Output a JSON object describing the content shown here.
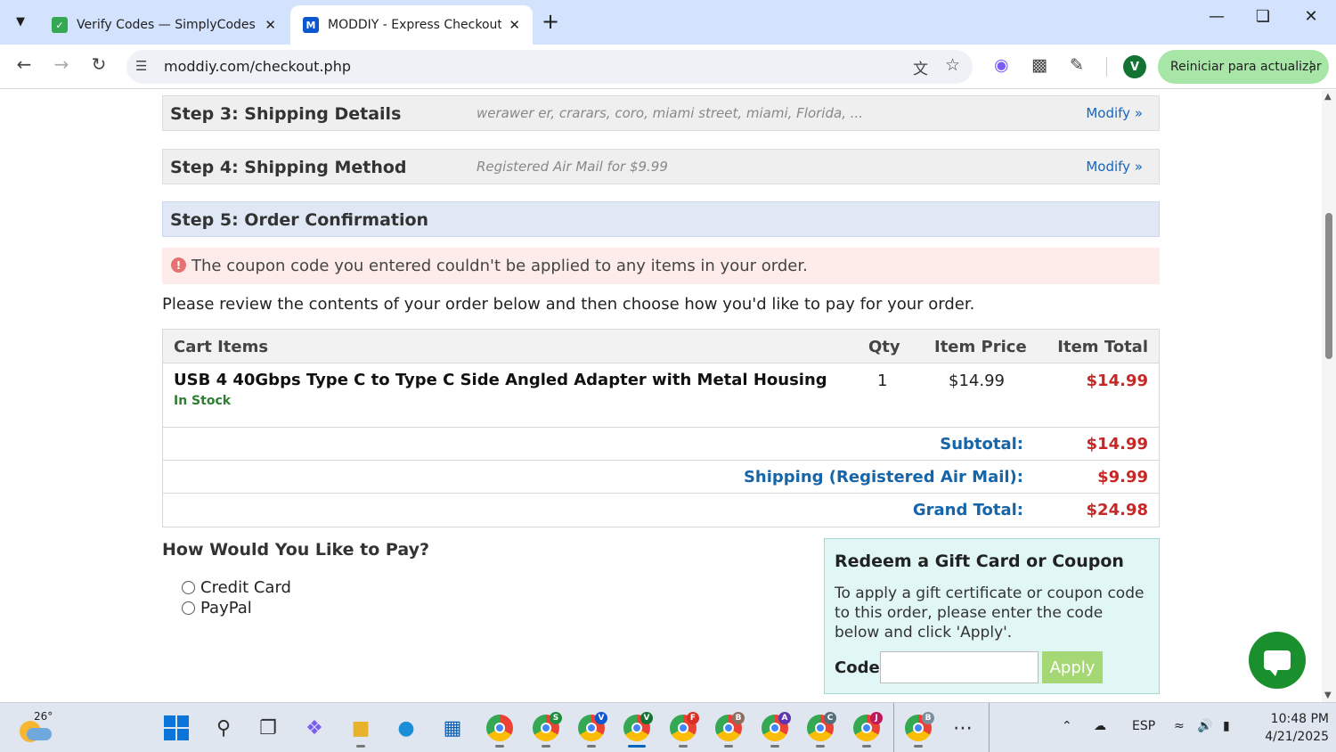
{
  "browser": {
    "tabs": [
      {
        "title": "Verify Codes — SimplyCodes",
        "favicon": "simplycodes-icon",
        "active": false
      },
      {
        "title": "MODDIY - Express Checkout",
        "favicon_letter": "M",
        "active": true
      }
    ],
    "url": "moddiy.com/checkout.php",
    "profile_initial": "V",
    "update_button": "Reiniciar para actualizar"
  },
  "checkout": {
    "steps": [
      {
        "title": "Step 3: Shipping Details",
        "summary": "werawer er, crarars, coro, miami street, miami, Florida, ...",
        "modify": "Modify »"
      },
      {
        "title": "Step 4: Shipping Method",
        "summary": "Registered Air Mail for $9.99",
        "modify": "Modify »"
      },
      {
        "title": "Step 5: Order Confirmation"
      }
    ],
    "alert": {
      "icon": "!",
      "text": "The coupon code you entered couldn't be applied to any items in your order."
    },
    "review_text": "Please review the contents of your order below and then choose how you'd like to pay for your order.",
    "cart": {
      "headers": {
        "items": "Cart Items",
        "qty": "Qty",
        "price": "Item Price",
        "total": "Item Total"
      },
      "items": [
        {
          "name": "USB 4 40Gbps Type C to Type C Side Angled Adapter with Metal Housing",
          "stock": "In Stock",
          "qty": "1",
          "price": "$14.99",
          "total": "$14.99"
        }
      ],
      "summary": [
        {
          "label": "Subtotal:",
          "value": "$14.99"
        },
        {
          "label": "Shipping (Registered Air Mail):",
          "value": "$9.99"
        },
        {
          "label": "Grand Total:",
          "value": "$24.98"
        }
      ]
    },
    "payment": {
      "title": "How Would You Like to Pay?",
      "options": [
        "Credit Card",
        "PayPal"
      ]
    },
    "gift": {
      "title": "Redeem a Gift Card or Coupon",
      "description": "To apply a gift certificate or coupon code to this order, please enter the code below and click 'Apply'.",
      "code_label": "Code:",
      "code_value": "",
      "apply_label": "Apply"
    }
  },
  "taskbar": {
    "temperature": "26°",
    "chrome_badges": [
      "S",
      "V",
      "V",
      "F",
      "B",
      "A",
      "C",
      "J",
      "B"
    ],
    "language": "ESP",
    "time": "10:48 PM",
    "date": "4/21/2025"
  },
  "colors": {
    "accent_link": "#1565c0",
    "price_red": "#c62828",
    "summary_blue": "#1565a8",
    "in_stock_green": "#2e7d32",
    "apply_green": "#a5d774",
    "gift_box_bg": "#e0f7f6",
    "alert_bg": "#fdecea"
  }
}
